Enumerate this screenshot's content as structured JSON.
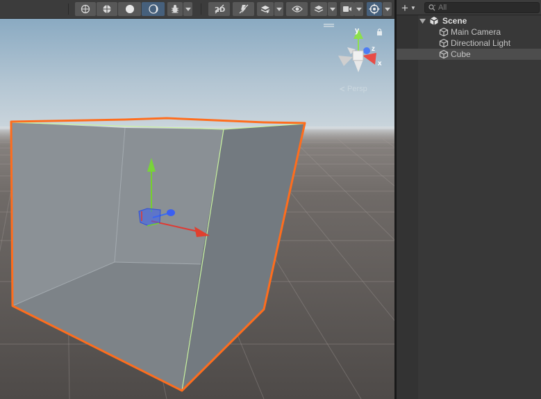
{
  "scene_toolbar": {
    "buttons": [
      {
        "name": "draw-mode-wireframe-icon"
      },
      {
        "name": "draw-mode-shaded-wireframe-icon"
      },
      {
        "name": "draw-mode-unlit-icon"
      },
      {
        "name": "draw-mode-shaded-icon",
        "active": true
      },
      {
        "name": "debug-draw-icon"
      },
      {
        "name": "2d-toggle-icon"
      },
      {
        "name": "lighting-toggle-icon"
      },
      {
        "name": "audio-effects-icon"
      },
      {
        "name": "visibility-icon"
      },
      {
        "name": "layers-icon"
      },
      {
        "name": "camera-icon"
      },
      {
        "name": "gizmos-icon"
      }
    ]
  },
  "colors": {
    "accent": "#46607c",
    "selection_outline": "#ff6d1d",
    "axis_x": "#e03a33",
    "axis_y": "#75d12c",
    "axis_z": "#3a6df0",
    "edge_highlight": "#c9f3a0"
  },
  "orientation_gizmo": {
    "axes": [
      "y",
      "z",
      "x"
    ],
    "projection_label": "Persp"
  },
  "hierarchy": {
    "search": {
      "placeholder": "All",
      "value": ""
    },
    "add_label": "+",
    "items": [
      {
        "label": "Scene",
        "icon": "unity-scene-icon",
        "expanded": true
      },
      {
        "label": "Main Camera",
        "icon": "gameobject-cube-icon"
      },
      {
        "label": "Directional Light",
        "icon": "gameobject-cube-icon"
      },
      {
        "label": "Cube",
        "icon": "gameobject-cube-icon",
        "selected": true
      }
    ]
  }
}
